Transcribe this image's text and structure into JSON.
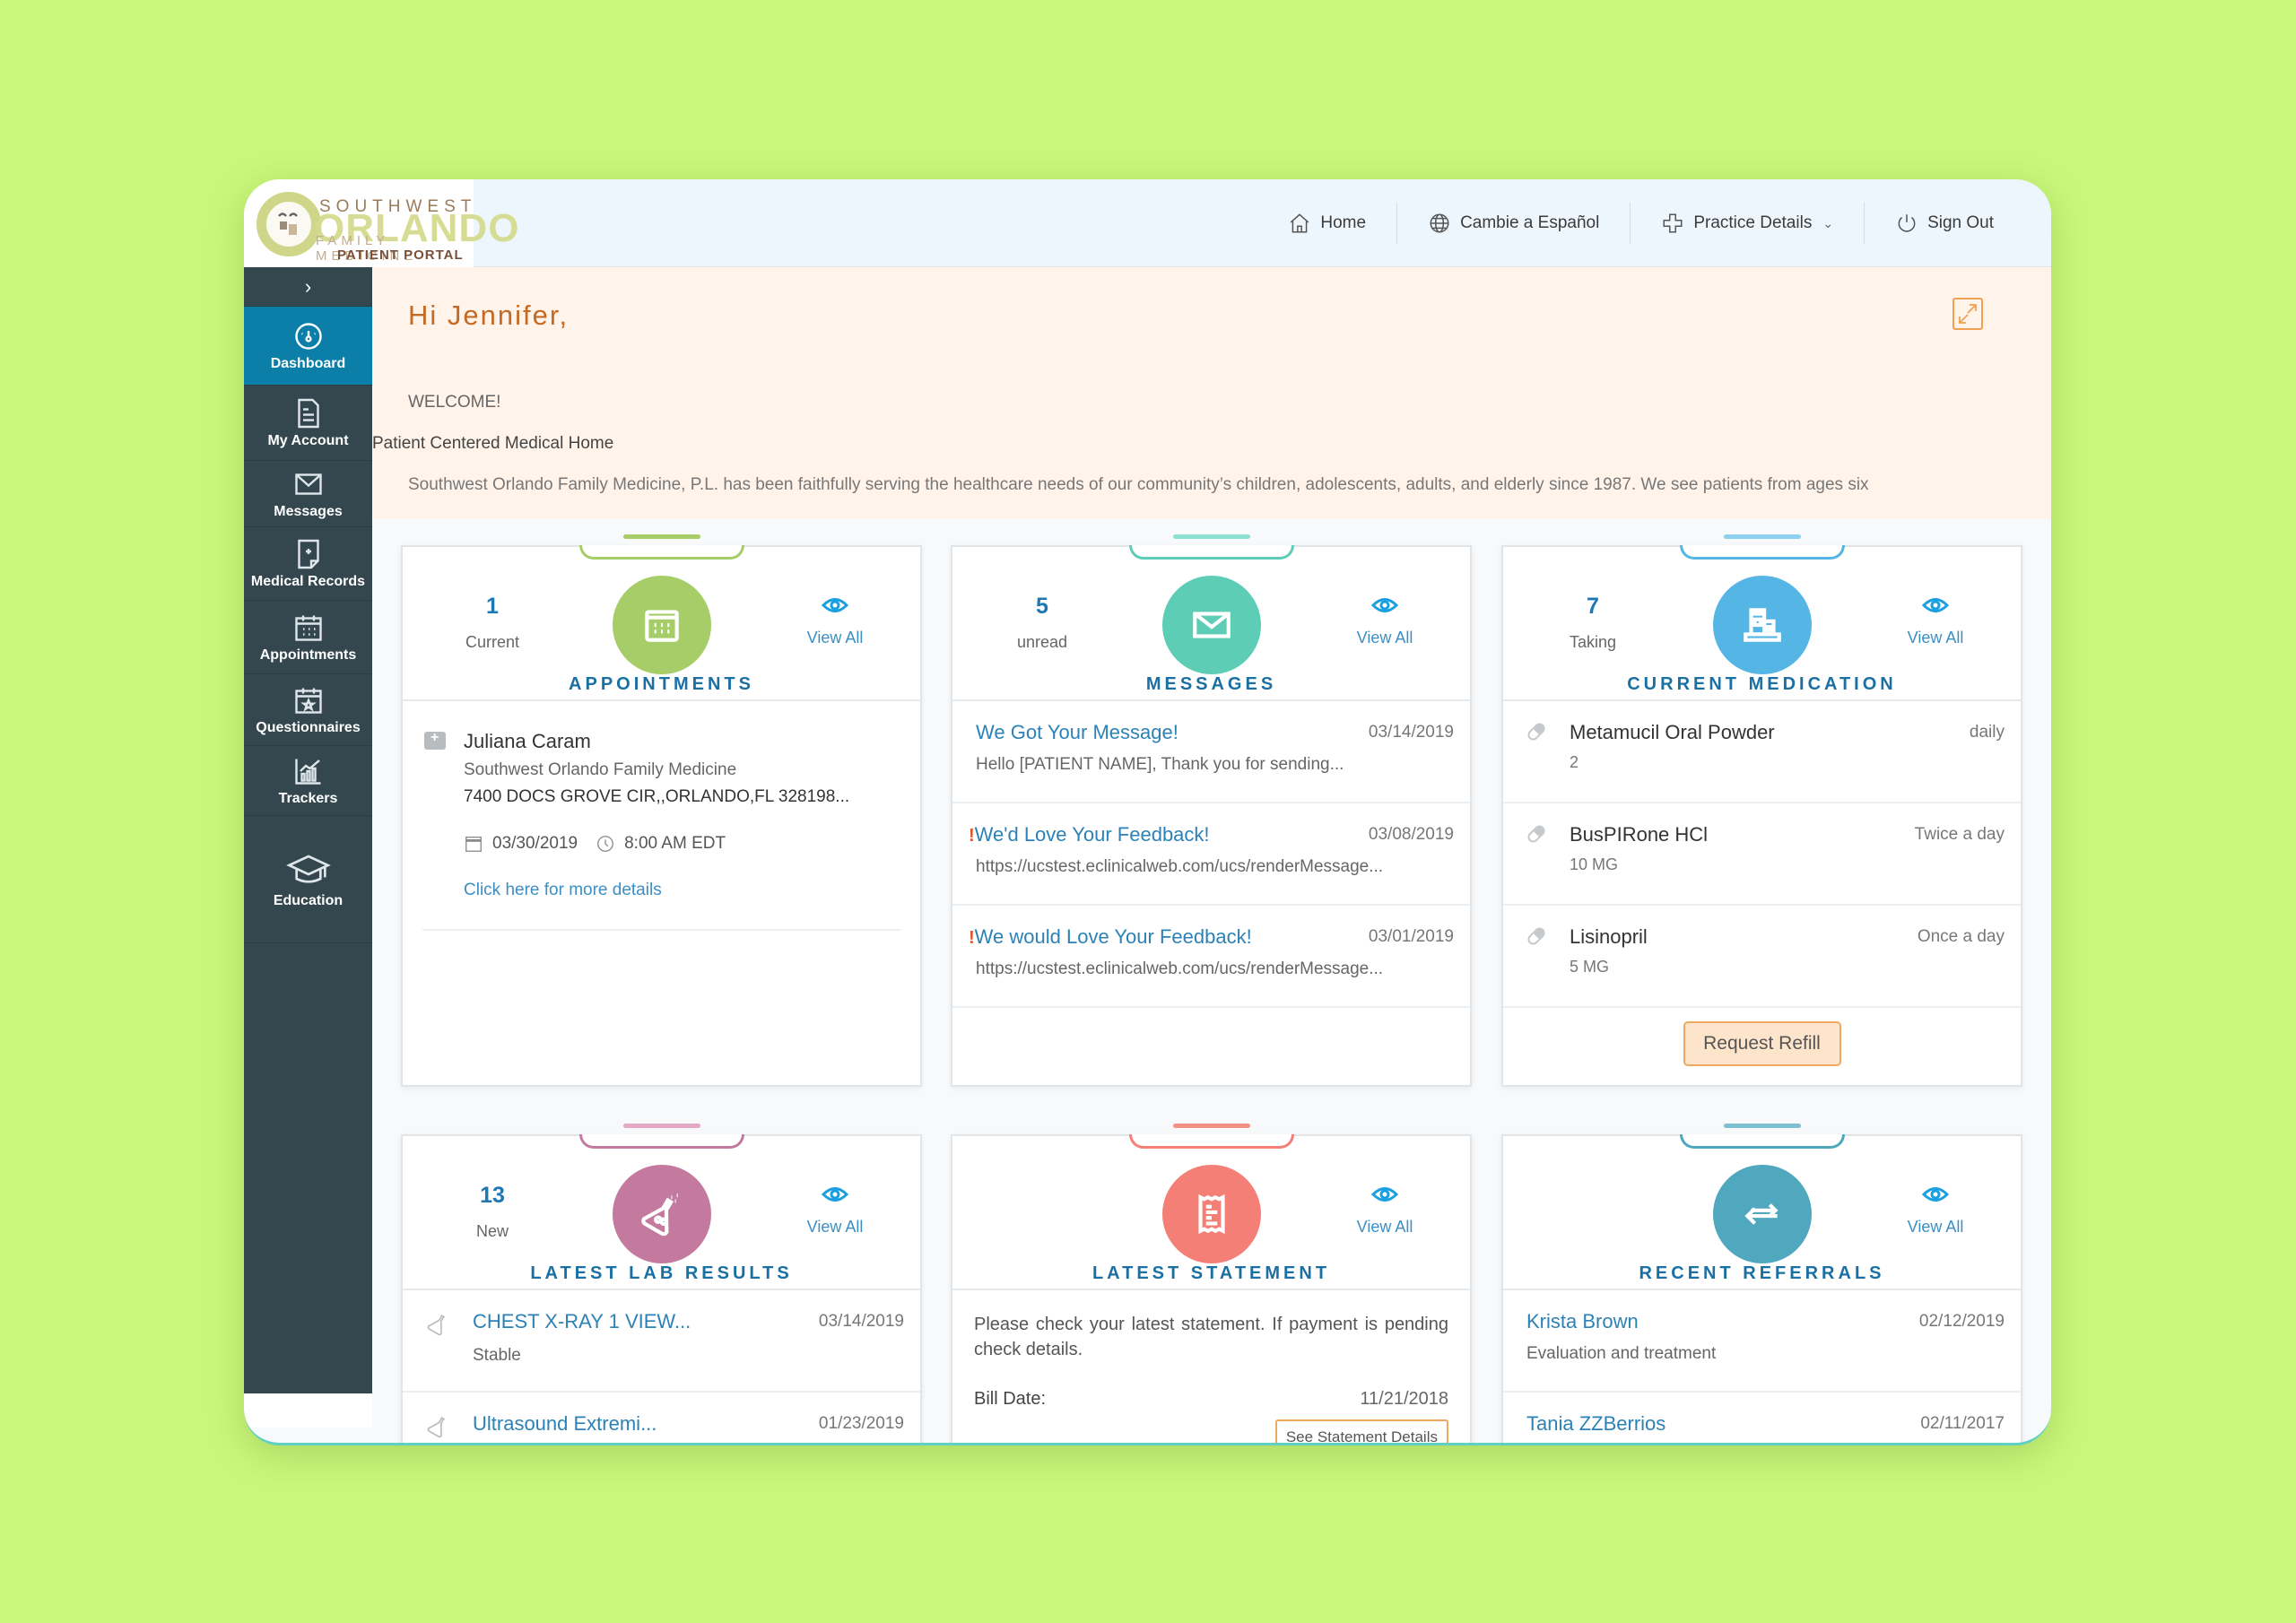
{
  "logo": {
    "line1": "SOUTHWEST",
    "line2": "ORLANDO",
    "line3": "FAMILY MEDICINE",
    "line4": "PATIENT PORTAL"
  },
  "topnav": {
    "home": "Home",
    "language": "Cambie a Español",
    "practice": "Practice Details",
    "signout": "Sign Out"
  },
  "sidebar": {
    "toggle": "›",
    "items": [
      {
        "label": "Dashboard",
        "icon": "dashboard-gauge-icon",
        "active": true
      },
      {
        "label": "My Account",
        "icon": "document-icon"
      },
      {
        "label": "Messages",
        "icon": "envelope-icon"
      },
      {
        "label": "Medical Records",
        "icon": "medical-record-icon"
      },
      {
        "label": "Appointments",
        "icon": "calendar-icon"
      },
      {
        "label": "Questionnaires",
        "icon": "calendar-star-icon"
      },
      {
        "label": "Trackers",
        "icon": "chart-trend-icon"
      },
      {
        "label": "Education",
        "icon": "graduation-cap-icon"
      }
    ]
  },
  "banner": {
    "greeting": "Hi Jennifer,",
    "welcome": "WELCOME!",
    "subtitle": "Patient Centered Medical Home",
    "description": "Southwest Orlando Family Medicine, P.L. has been faithfully serving the healthcare needs of our community’s children, adolescents, adults, and elderly since 1987. We see patients from ages six"
  },
  "colors": {
    "appointments": "#a6cd68",
    "messages": "#5ecdb6",
    "medication": "#55b6e6",
    "lab": "#c37a9e",
    "statement": "#f47f76",
    "referrals": "#4fa8bd",
    "title": "#1a6fa3",
    "accent": "#f0a860"
  },
  "cards": {
    "appointments": {
      "count": "1",
      "count_label": "Current",
      "title": "APPOINTMENTS",
      "view_all": "View All",
      "item": {
        "name": "Juliana Caram",
        "facility": "Southwest Orlando Family Medicine",
        "address": "7400 DOCS GROVE CIR,,ORLANDO,FL 328198...",
        "date": "03/30/2019",
        "time": "8:00 AM EDT",
        "link": "Click here for more details"
      }
    },
    "messages": {
      "count": "5",
      "count_label": "unread",
      "title": "MESSAGES",
      "view_all": "View All",
      "items": [
        {
          "title": "We Got Your Message!",
          "date": "03/14/2019",
          "preview": "Hello [PATIENT NAME], Thank you for sending...",
          "priority": false
        },
        {
          "title": "We'd Love Your Feedback!",
          "date": "03/08/2019",
          "preview": "https://ucstest.eclinicalweb.com/ucs/renderMessage...",
          "priority": true
        },
        {
          "title": "We would Love Your Feedback!",
          "date": "03/01/2019",
          "preview": "https://ucstest.eclinicalweb.com/ucs/renderMessage...",
          "priority": true
        }
      ]
    },
    "medication": {
      "count": "7",
      "count_label": "Taking",
      "title": "CURRENT MEDICATION",
      "view_all": "View All",
      "items": [
        {
          "name": "Metamucil Oral Powder",
          "dose": "2",
          "frequency": "daily"
        },
        {
          "name": "BusPIRone HCl",
          "dose": "10 MG",
          "frequency": "Twice a day"
        },
        {
          "name": "Lisinopril",
          "dose": "5 MG",
          "frequency": "Once a day"
        }
      ],
      "refill_button": "Request Refill"
    },
    "lab": {
      "count": "13",
      "count_label": "New",
      "title": "LATEST LAB RESULTS",
      "view_all": "View All",
      "items": [
        {
          "name": "CHEST X-RAY 1 VIEW...",
          "date": "03/14/2019",
          "status": "Stable"
        },
        {
          "name": "Ultrasound Extremi...",
          "date": "01/23/2019",
          "status": ""
        }
      ]
    },
    "statement": {
      "title": "LATEST STATEMENT",
      "view_all": "View All",
      "text": "Please check your latest statement. If payment is pending check details.",
      "bill_label": "Bill Date:",
      "bill_date": "11/21/2018",
      "details_button": "See Statement Details"
    },
    "referrals": {
      "title": "RECENT REFERRALS",
      "view_all": "View All",
      "items": [
        {
          "name": "Krista Brown",
          "date": "02/12/2019",
          "reason": "Evaluation and treatment"
        },
        {
          "name": "Tania ZZBerrios",
          "date": "02/11/2017",
          "reason": ""
        }
      ]
    }
  }
}
